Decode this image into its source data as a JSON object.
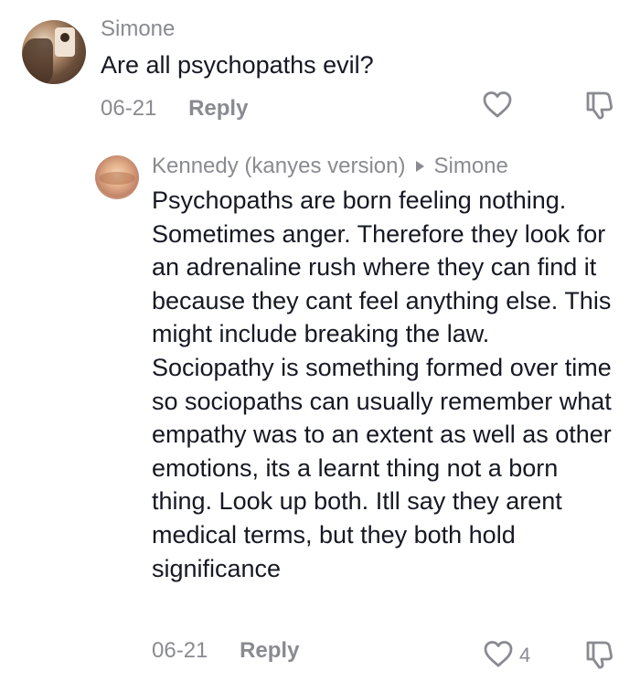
{
  "comments": [
    {
      "username": "Simone",
      "text": "Are all psychopaths evil?",
      "date": "06-21",
      "reply_label": "Reply"
    },
    {
      "username": "Kennedy (kanyes version)",
      "reply_to": "Simone",
      "text": "Psychopaths are born feeling nothing. Sometimes anger. Therefore they look for an adrenaline rush where they can find it because they cant feel anything else. This might include breaking the law. Sociopathy is something formed over time so sociopaths can usually remember what empathy was to an extent as well as other emotions, its a learnt thing not a born thing. Look up both. Itll say they arent medical terms, but they both hold significance",
      "date": "06-21",
      "reply_label": "Reply",
      "like_count": "4"
    }
  ],
  "colors": {
    "text": "#161823",
    "secondary": "#8a8b91"
  },
  "icons": [
    "heart-outline-icon",
    "thumbs-down-icon",
    "reply-arrow-icon"
  ]
}
